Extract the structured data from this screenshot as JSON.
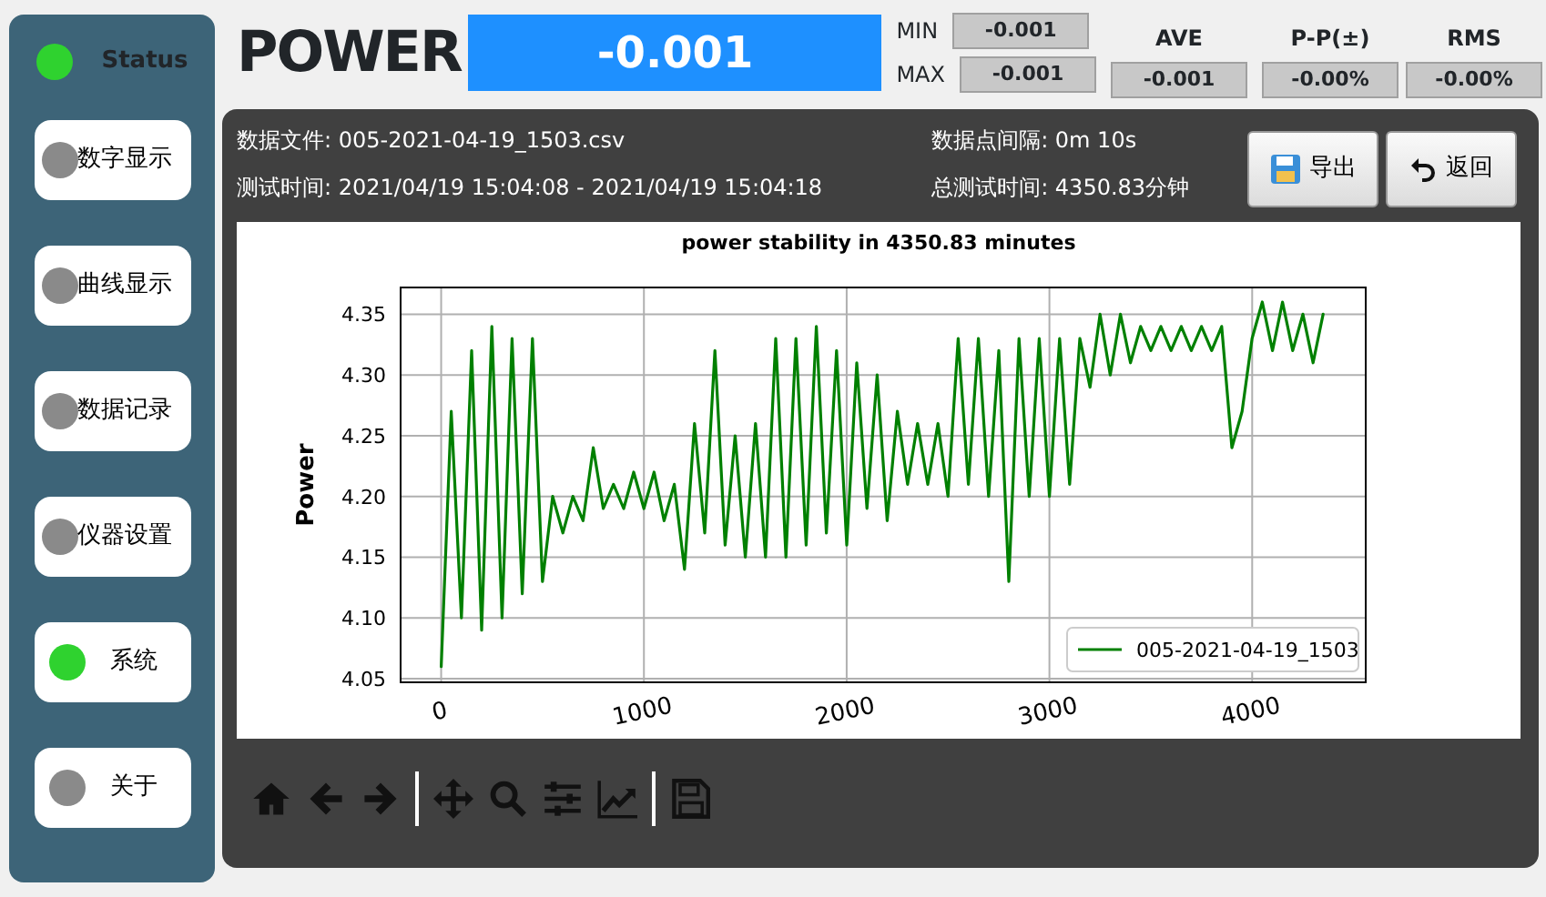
{
  "status": {
    "label": "Status",
    "on": true
  },
  "sidebar": {
    "items": [
      {
        "label": "数字显示",
        "on": false
      },
      {
        "label": "曲线显示",
        "on": false
      },
      {
        "label": "数据记录",
        "on": false
      },
      {
        "label": "仪器设置",
        "on": false
      },
      {
        "label": "系统",
        "on": true
      },
      {
        "label": "关于",
        "on": false
      }
    ]
  },
  "readout": {
    "title": "POWER",
    "value": "-0.001",
    "min_label": "MIN",
    "min": "-0.001",
    "max_label": "MAX",
    "max": "-0.001",
    "stats": [
      {
        "label": "AVE",
        "value": "-0.001"
      },
      {
        "label": "P-P(±)",
        "value": "-0.00%"
      },
      {
        "label": "RMS",
        "value": "-0.00%"
      }
    ]
  },
  "panel": {
    "file": "数据文件: 005-2021-04-19_1503.csv",
    "test_time": "测试时间: 2021/04/19 15:04:08 - 2021/04/19 15:04:18",
    "interval": "数据点间隔: 0m 10s",
    "total_time": "总测试时间: 4350.83分钟",
    "buttons": [
      {
        "label": "导出",
        "kind": "export"
      },
      {
        "label": "返回",
        "kind": "back"
      }
    ],
    "chart_data": {
      "type": "line",
      "title": "power stability in 4350.83 minutes",
      "ylabel": "Power",
      "x": [
        0,
        50,
        100,
        150,
        200,
        250,
        300,
        350,
        400,
        450,
        500,
        550,
        600,
        650,
        700,
        750,
        800,
        850,
        900,
        950,
        1000,
        1050,
        1100,
        1150,
        1200,
        1250,
        1300,
        1350,
        1400,
        1450,
        1500,
        1550,
        1600,
        1650,
        1700,
        1750,
        1800,
        1850,
        1900,
        1950,
        2000,
        2050,
        2100,
        2150,
        2200,
        2250,
        2300,
        2350,
        2400,
        2450,
        2500,
        2550,
        2600,
        2650,
        2700,
        2750,
        2800,
        2850,
        2900,
        2950,
        3000,
        3050,
        3100,
        3150,
        3200,
        3250,
        3300,
        3350,
        3400,
        3450,
        3500,
        3550,
        3600,
        3650,
        3700,
        3750,
        3800,
        3850,
        3900,
        3950,
        4000,
        4050,
        4100,
        4150,
        4200,
        4250,
        4300,
        4350
      ],
      "series": [
        {
          "name": "005-2021-04-19_1503",
          "color": "#008000",
          "values": [
            4.06,
            4.27,
            4.1,
            4.32,
            4.09,
            4.34,
            4.1,
            4.33,
            4.12,
            4.33,
            4.13,
            4.2,
            4.17,
            4.2,
            4.18,
            4.24,
            4.19,
            4.21,
            4.19,
            4.22,
            4.19,
            4.22,
            4.18,
            4.21,
            4.14,
            4.26,
            4.17,
            4.32,
            4.16,
            4.25,
            4.15,
            4.26,
            4.15,
            4.33,
            4.15,
            4.33,
            4.16,
            4.34,
            4.17,
            4.32,
            4.16,
            4.31,
            4.19,
            4.3,
            4.18,
            4.27,
            4.21,
            4.26,
            4.21,
            4.26,
            4.2,
            4.33,
            4.21,
            4.33,
            4.2,
            4.32,
            4.13,
            4.33,
            4.2,
            4.33,
            4.2,
            4.33,
            4.21,
            4.33,
            4.29,
            4.35,
            4.3,
            4.35,
            4.31,
            4.34,
            4.32,
            4.34,
            4.32,
            4.34,
            4.32,
            4.34,
            4.32,
            4.34,
            4.24,
            4.27,
            4.33,
            4.36,
            4.32,
            4.36,
            4.32,
            4.35,
            4.31,
            4.35
          ]
        }
      ],
      "grid": true,
      "xlim": [
        -200,
        4560
      ],
      "ylim": [
        4.047,
        4.372
      ],
      "xticks": [
        0,
        1000,
        2000,
        3000,
        4000
      ],
      "yticks": [
        {
          "value": 4.05,
          "label": "4.05"
        },
        {
          "value": 4.1,
          "label": "4.10"
        },
        {
          "value": 4.15,
          "label": "4.15"
        },
        {
          "value": 4.2,
          "label": "4.20"
        },
        {
          "value": 4.25,
          "label": "4.25"
        },
        {
          "value": 4.3,
          "label": "4.30"
        },
        {
          "value": 4.35,
          "label": "4.35"
        }
      ]
    }
  }
}
